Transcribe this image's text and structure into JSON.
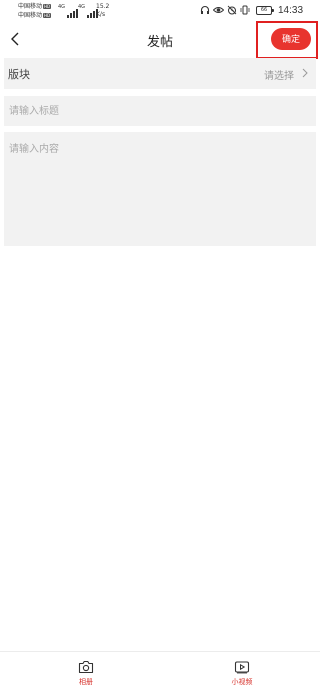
{
  "status_bar": {
    "carrier1": "中国移动",
    "carrier2": "中国移动",
    "hd": "HD",
    "network": "4G",
    "speed_value": "15.2",
    "speed_unit": "K/s",
    "battery": "66",
    "time": "14:33"
  },
  "nav": {
    "title": "发帖",
    "confirm_label": "确定"
  },
  "form": {
    "board_label": "版块",
    "board_value": "请选择",
    "title_placeholder": "请输入标题",
    "content_placeholder": "请输入内容"
  },
  "toolbar": {
    "album_label": "相册",
    "video_label": "小视频"
  },
  "colors": {
    "accent": "#e8342e",
    "highlight": "#e02020",
    "field_bg": "#f2f2f2"
  }
}
